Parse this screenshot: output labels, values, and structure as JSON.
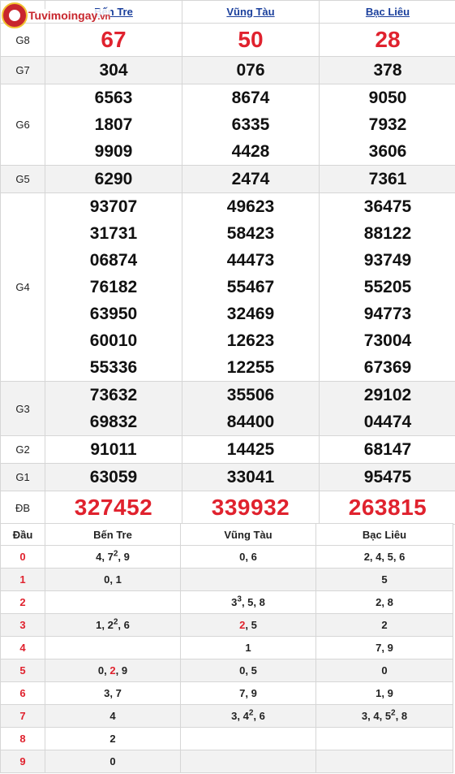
{
  "logo": {
    "text": "Tuvimoingay",
    "suffix": ".vn"
  },
  "provinces": [
    "Bến Tre",
    "Vũng Tàu",
    "Bạc Liêu"
  ],
  "prizes": {
    "g8": {
      "label": "G8",
      "values": [
        "67",
        "50",
        "28"
      ]
    },
    "g7": {
      "label": "G7",
      "values": [
        "304",
        "076",
        "378"
      ]
    },
    "g6": {
      "label": "G6",
      "values": [
        [
          "6563",
          "1807",
          "9909"
        ],
        [
          "8674",
          "6335",
          "4428"
        ],
        [
          "9050",
          "7932",
          "3606"
        ]
      ]
    },
    "g5": {
      "label": "G5",
      "values": [
        "6290",
        "2474",
        "7361"
      ]
    },
    "g4": {
      "label": "G4",
      "values": [
        [
          "93707",
          "31731",
          "06874",
          "76182",
          "63950",
          "60010",
          "55336"
        ],
        [
          "49623",
          "58423",
          "44473",
          "55467",
          "32469",
          "12623",
          "12255"
        ],
        [
          "36475",
          "88122",
          "93749",
          "55205",
          "94773",
          "73004",
          "67369"
        ]
      ]
    },
    "g3": {
      "label": "G3",
      "values": [
        [
          "73632",
          "69832"
        ],
        [
          "35506",
          "84400"
        ],
        [
          "29102",
          "04474"
        ]
      ]
    },
    "g2": {
      "label": "G2",
      "values": [
        "91011",
        "14425",
        "68147"
      ]
    },
    "g1": {
      "label": "G1",
      "values": [
        "63059",
        "33041",
        "95475"
      ]
    },
    "db": {
      "label": "ĐB",
      "values": [
        "327452",
        "339932",
        "263815"
      ]
    }
  },
  "loto": {
    "head": [
      "Đầu",
      "Bến Tre",
      "Vũng Tàu",
      "Bạc Liêu"
    ],
    "rows": [
      {
        "dau": "0",
        "cells": [
          "4, 7², 9",
          "0, 6",
          "2, 4, 5, 6"
        ]
      },
      {
        "dau": "1",
        "cells": [
          "0, 1",
          "",
          "5"
        ]
      },
      {
        "dau": "2",
        "cells": [
          "",
          "3³, 5, 8",
          "2, 8"
        ]
      },
      {
        "dau": "3",
        "cells": [
          "1, 2², 6",
          "2, 5",
          "2"
        ]
      },
      {
        "dau": "4",
        "cells": [
          "",
          "1",
          "7, 9"
        ]
      },
      {
        "dau": "5",
        "cells": [
          "0, 2, 9",
          "0, 5",
          "0"
        ]
      },
      {
        "dau": "6",
        "cells": [
          "3, 7",
          "7, 9",
          "1, 9"
        ]
      },
      {
        "dau": "7",
        "cells": [
          "4",
          "3, 4², 6",
          "3, 4, 5², 8"
        ]
      },
      {
        "dau": "8",
        "cells": [
          "2",
          "",
          ""
        ]
      },
      {
        "dau": "9",
        "cells": [
          "0",
          "",
          ""
        ]
      }
    ]
  },
  "colors": {
    "accent": "#e0222e",
    "link": "#1a3f9c",
    "stripe": "#f2f2f2"
  }
}
